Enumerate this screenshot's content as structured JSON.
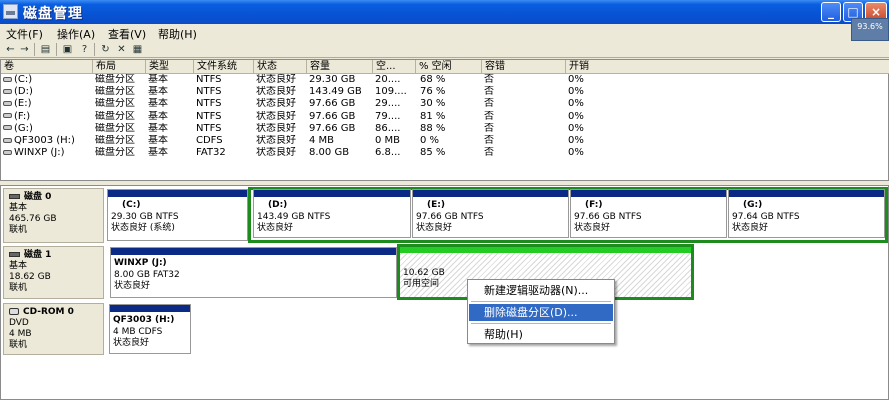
{
  "window": {
    "title": "磁盘管理",
    "gauge": "93.6%"
  },
  "menu": {
    "items": [
      "文件(F)",
      "操作(A)",
      "查看(V)",
      "帮助(H)"
    ]
  },
  "toolbar": {
    "icons": [
      "back-icon",
      "forward-icon",
      "console-tree-icon",
      "properties-icon",
      "help-icon",
      "refresh-icon",
      "delete-icon",
      "properties-page-icon"
    ]
  },
  "volumes": {
    "columns": [
      "卷",
      "布局",
      "类型",
      "文件系统",
      "状态",
      "容量",
      "空...",
      "% 空闲",
      "容错",
      "开销"
    ],
    "rows": [
      [
        "(C:)",
        "磁盘分区",
        "基本",
        "NTFS",
        "状态良好",
        "29.30 GB",
        "20....",
        "68 %",
        "否",
        "0%"
      ],
      [
        "(D:)",
        "磁盘分区",
        "基本",
        "NTFS",
        "状态良好",
        "143.49 GB",
        "109....",
        "76 %",
        "否",
        "0%"
      ],
      [
        "(E:)",
        "磁盘分区",
        "基本",
        "NTFS",
        "状态良好",
        "97.66 GB",
        "29....",
        "30 %",
        "否",
        "0%"
      ],
      [
        "(F:)",
        "磁盘分区",
        "基本",
        "NTFS",
        "状态良好",
        "97.66 GB",
        "79....",
        "81 %",
        "否",
        "0%"
      ],
      [
        "(G:)",
        "磁盘分区",
        "基本",
        "NTFS",
        "状态良好",
        "97.66 GB",
        "86....",
        "88 %",
        "否",
        "0%"
      ],
      [
        "QF3003 (H:)",
        "磁盘分区",
        "基本",
        "CDFS",
        "状态良好",
        "4 MB",
        "0 MB",
        "0 %",
        "否",
        "0%"
      ],
      [
        "WINXP (J:)",
        "磁盘分区",
        "基本",
        "FAT32",
        "状态良好",
        "8.00 GB",
        "6.8...",
        "85 %",
        "否",
        "0%"
      ]
    ]
  },
  "disks": [
    {
      "label": "磁盘 0",
      "type": "基本",
      "size": "465.76 GB",
      "status": "联机",
      "partitions": [
        {
          "name": "(C:)",
          "size": "29.30 GB NTFS",
          "status": "状态良好 (系统)"
        },
        {
          "name": "(D:)",
          "size": "143.49 GB NTFS",
          "status": "状态良好"
        },
        {
          "name": "(E:)",
          "size": "97.66 GB NTFS",
          "status": "状态良好"
        },
        {
          "name": "(F:)",
          "size": "97.66 GB NTFS",
          "status": "状态良好"
        },
        {
          "name": "(G:)",
          "size": "97.64 GB NTFS",
          "status": "状态良好"
        }
      ]
    },
    {
      "label": "磁盘 1",
      "type": "基本",
      "size": "18.62 GB",
      "status": "联机",
      "partitions": [
        {
          "name": "WINXP  (J:)",
          "size": "8.00 GB FAT32",
          "status": "状态良好"
        },
        {
          "name": "",
          "size": "10.62 GB",
          "status": "可用空间"
        }
      ]
    },
    {
      "label": "CD-ROM 0",
      "type": "DVD",
      "size": "4 MB",
      "status": "联机",
      "partitions": [
        {
          "name": "QF3003  (H:)",
          "size": "4 MB CDFS",
          "status": "状态良好"
        }
      ]
    }
  ],
  "context_menu": {
    "items": [
      "新建逻辑驱动器(N)...",
      "删除磁盘分区(D)...",
      "帮助(H)"
    ],
    "highlighted_index": 1
  },
  "colors": {
    "titlebar": "#0a5fe0",
    "partition_bar": "#0b2a85",
    "free_space_bar": "#22cc22",
    "selection_border": "#1d8b1d",
    "menu_highlight": "#316ac5"
  }
}
